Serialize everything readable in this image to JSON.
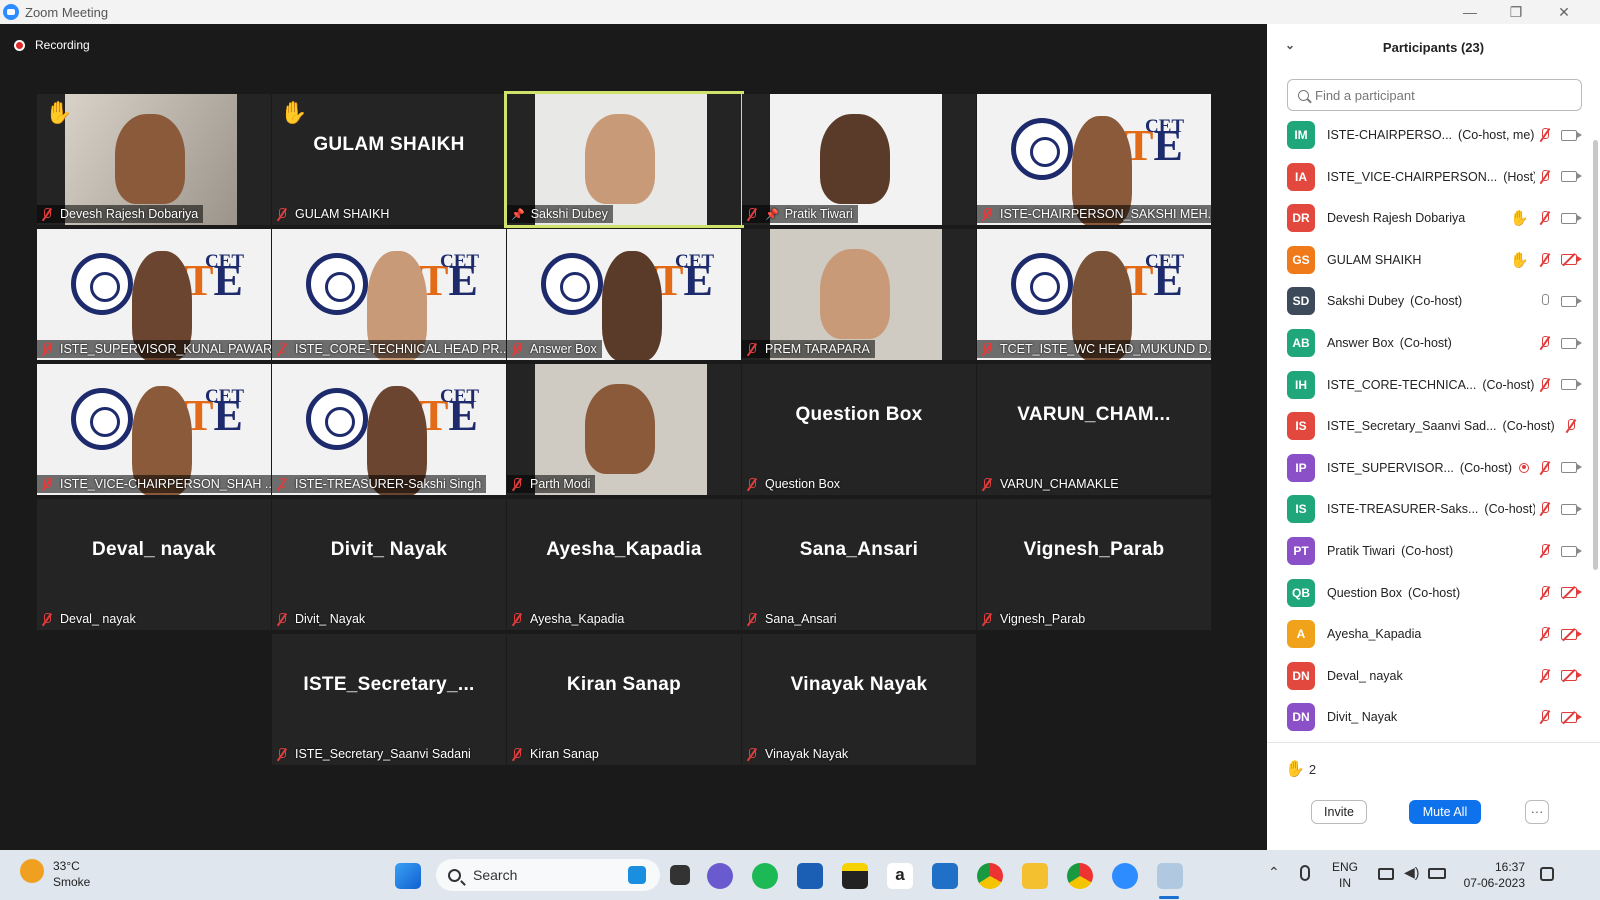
{
  "window": {
    "title": "Zoom Meeting",
    "minimize": "—",
    "restore": "❐",
    "close": "✕"
  },
  "recording": {
    "label": "Recording"
  },
  "grid": {
    "tiles": [
      {
        "name": "Devesh Rajesh Dobariya",
        "video": "person",
        "hand": true,
        "mic": "muted"
      },
      {
        "name": "GULAM SHAIKH",
        "big": "GULAM SHAIKH",
        "hand": true,
        "mic": "muted"
      },
      {
        "name": "Sakshi Dubey",
        "video": "person",
        "active": true,
        "pinned": true,
        "mic": "none"
      },
      {
        "name": "Pratik Tiwari",
        "video": "person",
        "pinned": true,
        "mic": "muted"
      },
      {
        "name": "ISTE-CHAIRPERSON_SAKSHI MEH...",
        "video": "logo",
        "mic": "muted"
      },
      {
        "name": "ISTE_SUPERVISOR_KUNAL PAWAR",
        "video": "logo",
        "mic": "muted"
      },
      {
        "name": "ISTE_CORE-TECHNICAL HEAD PR...",
        "video": "logo",
        "mic": "muted"
      },
      {
        "name": "Answer Box",
        "video": "logo",
        "mic": "muted"
      },
      {
        "name": "PREM TARAPARA",
        "video": "person",
        "mic": "muted"
      },
      {
        "name": "TCET_ISTE_WC HEAD_MUKUND D...",
        "video": "logo",
        "mic": "muted"
      },
      {
        "name": "ISTE_VICE-CHAIRPERSON_SHAH ...",
        "video": "logo",
        "mic": "muted"
      },
      {
        "name": "ISTE-TREASURER-Sakshi Singh",
        "video": "logo",
        "mic": "muted"
      },
      {
        "name": "Parth Modi",
        "video": "person",
        "mic": "muted"
      },
      {
        "name": "Question Box",
        "big": "Question Box",
        "mic": "muted"
      },
      {
        "name": "VARUN_CHAMAKLE",
        "big": "VARUN_CHAM...",
        "mic": "muted"
      },
      {
        "name": "Deval_ nayak",
        "big": "Deval_ nayak",
        "mic": "muted"
      },
      {
        "name": "Divit_ Nayak",
        "big": "Divit_ Nayak",
        "mic": "muted"
      },
      {
        "name": "Ayesha_Kapadia",
        "big": "Ayesha_Kapadia",
        "mic": "muted"
      },
      {
        "name": "Sana_Ansari",
        "big": "Sana_Ansari",
        "mic": "muted"
      },
      {
        "name": "Vignesh_Parab",
        "big": "Vignesh_Parab",
        "mic": "muted"
      },
      {
        "name": "ISTE_Secretary_Saanvi Sadani",
        "big": "ISTE_Secretary_...",
        "mic": "muted"
      },
      {
        "name": "Kiran Sanap",
        "big": "Kiran Sanap",
        "mic": "muted"
      },
      {
        "name": "Vinayak Nayak",
        "big": "Vinayak Nayak",
        "mic": "muted"
      }
    ]
  },
  "panel": {
    "title": "Participants (23)",
    "collapse_icon": "chevron-down-icon",
    "search_placeholder": "Find a participant",
    "participants": [
      {
        "initials": "IM",
        "color": "#1fa67a",
        "name": "ISTE-CHAIRPERSO...",
        "role": "(Co-host, me)",
        "mic": "muted",
        "cam": "on"
      },
      {
        "initials": "IA",
        "color": "#e2483d",
        "name": "ISTE_VICE-CHAIRPERSON...",
        "role": "(Host)",
        "mic": "muted",
        "cam": "on"
      },
      {
        "initials": "DR",
        "color": "#e2483d",
        "name": "Devesh Rajesh Dobariya",
        "role": "",
        "hand": true,
        "mic": "muted",
        "cam": "on"
      },
      {
        "initials": "GS",
        "color": "#f07a1a",
        "name": "GULAM SHAIKH",
        "role": "",
        "hand": true,
        "mic": "muted",
        "cam": "off"
      },
      {
        "initials": "SD",
        "color": "#3c4a5a",
        "name": "Sakshi Dubey",
        "role": "(Co-host)",
        "mic": "on",
        "cam": "on"
      },
      {
        "initials": "AB",
        "color": "#1fa67a",
        "name": "Answer Box",
        "role": "(Co-host)",
        "mic": "muted",
        "cam": "on"
      },
      {
        "initials": "IH",
        "color": "#1fa67a",
        "name": "ISTE_CORE-TECHNICA...",
        "role": "(Co-host)",
        "mic": "muted",
        "cam": "on"
      },
      {
        "initials": "IS",
        "color": "#e2483d",
        "name": "ISTE_Secretary_Saanvi Sad...",
        "role": "(Co-host)",
        "mic": "muted",
        "cam": "none"
      },
      {
        "initials": "IP",
        "color": "#8b4fc8",
        "name": "ISTE_SUPERVISOR...",
        "role": "(Co-host)",
        "rec": true,
        "mic": "muted",
        "cam": "on"
      },
      {
        "initials": "IS",
        "color": "#1fa67a",
        "name": "ISTE-TREASURER-Saks...",
        "role": "(Co-host)",
        "mic": "muted",
        "cam": "on"
      },
      {
        "initials": "PT",
        "color": "#8b4fc8",
        "name": "Pratik Tiwari",
        "role": "(Co-host)",
        "mic": "muted",
        "cam": "on"
      },
      {
        "initials": "QB",
        "color": "#1fa67a",
        "name": "Question Box",
        "role": "(Co-host)",
        "mic": "muted",
        "cam": "off"
      },
      {
        "initials": "A",
        "color": "#f0a21a",
        "name": "Ayesha_Kapadia",
        "role": "",
        "mic": "muted",
        "cam": "off"
      },
      {
        "initials": "DN",
        "color": "#e2483d",
        "name": "Deval_ nayak",
        "role": "",
        "mic": "muted",
        "cam": "off"
      },
      {
        "initials": "DN",
        "color": "#8b4fc8",
        "name": "Divit_ Nayak",
        "role": "",
        "mic": "muted",
        "cam": "off"
      }
    ],
    "raised_hands": "2",
    "invite_label": "Invite",
    "mute_all_label": "Mute All",
    "more_label": "···"
  },
  "taskbar": {
    "weather_temp": "33°C",
    "weather_desc": "Smoke",
    "search_label": "Search",
    "lang_1": "ENG",
    "lang_2": "IN",
    "time": "16:37",
    "date": "07-06-2023",
    "icons": [
      "windows-start-icon",
      "search-icon",
      "task-view-icon",
      "chat-icon",
      "spotify-icon",
      "store-icon",
      "sticky-notes-icon",
      "amazon-icon",
      "remote-desktop-icon",
      "chrome-icon",
      "file-explorer-icon",
      "chrome-profile-icon",
      "zoom-icon",
      "snipping-tool-icon"
    ]
  }
}
